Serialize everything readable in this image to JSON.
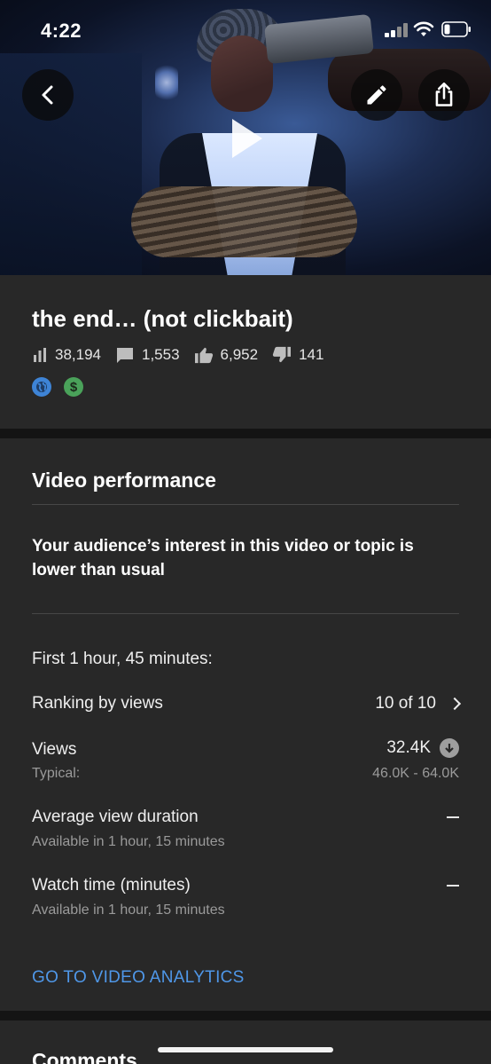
{
  "status_bar": {
    "time": "4:22"
  },
  "video": {
    "title": "the end… (not clickbait)",
    "views": "38,194",
    "comments": "1,553",
    "likes": "6,952",
    "dislikes": "141"
  },
  "performance": {
    "heading": "Video performance",
    "message": "Your audience’s interest in this video or topic is lower than usual",
    "period": "First 1 hour, 45 minutes:",
    "ranking": {
      "label": "Ranking by views",
      "value": "10 of 10"
    },
    "views": {
      "label": "Views",
      "value": "32.4K",
      "typical_label": "Typical:",
      "typical_value": "46.0K - 64.0K"
    },
    "avg_duration": {
      "label": "Average view duration",
      "note": "Available in 1 hour, 15 minutes"
    },
    "watch_time": {
      "label": "Watch time (minutes)",
      "note": "Available in 1 hour, 15 minutes"
    },
    "link": "GO TO VIDEO ANALYTICS"
  },
  "comments": {
    "heading": "Comments"
  },
  "icons": {
    "back": "back-arrow-icon",
    "edit": "pencil-icon",
    "share": "share-icon",
    "play": "play-icon",
    "views": "bar-chart-icon",
    "comments": "comment-icon",
    "likes": "thumbs-up-icon",
    "dislikes": "thumbs-down-icon",
    "visibility": "globe-icon",
    "monetization": "dollar-icon"
  },
  "colors": {
    "background": "#1b1b1b",
    "card": "#282828",
    "link": "#4f97e8",
    "globe": "#3e84d6",
    "monetization": "#4aa25a"
  }
}
